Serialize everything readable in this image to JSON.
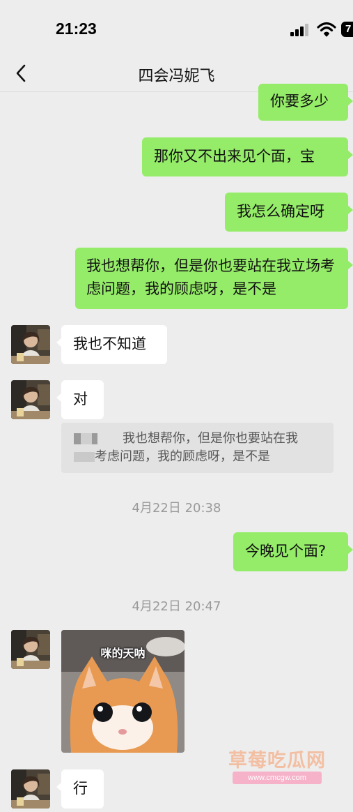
{
  "status_bar": {
    "time": "21:23",
    "battery": "7"
  },
  "nav": {
    "title": "四会冯妮飞"
  },
  "messages": {
    "m1": "你要多少",
    "m2": "那你又不出来见个面，宝",
    "m3": "我怎么确定呀",
    "m4": "我也想帮你，但是你也要站在我立场考虑问题，我的顾虑呀，是不是",
    "m5": "我也不知道",
    "m6": "对",
    "m7": "今晚见个面?",
    "m8": "行"
  },
  "quote": {
    "line1": "我也想帮你，但是你也要站在我",
    "line2": "考虑问题，我的顾虑呀，是不是"
  },
  "timestamps": {
    "t1": "4月22日 20:38",
    "t2": "4月22日 20:47"
  },
  "sticker": {
    "caption": "咪的天呐"
  },
  "watermark": {
    "text": "草莓吃瓜网",
    "url": "www.cmcgw.com"
  },
  "colors": {
    "outgoing_bubble": "#95ec69",
    "incoming_bubble": "#ffffff",
    "background": "#ededed"
  },
  "icons": [
    "back-icon",
    "signal-icon",
    "wifi-icon",
    "battery-icon"
  ]
}
